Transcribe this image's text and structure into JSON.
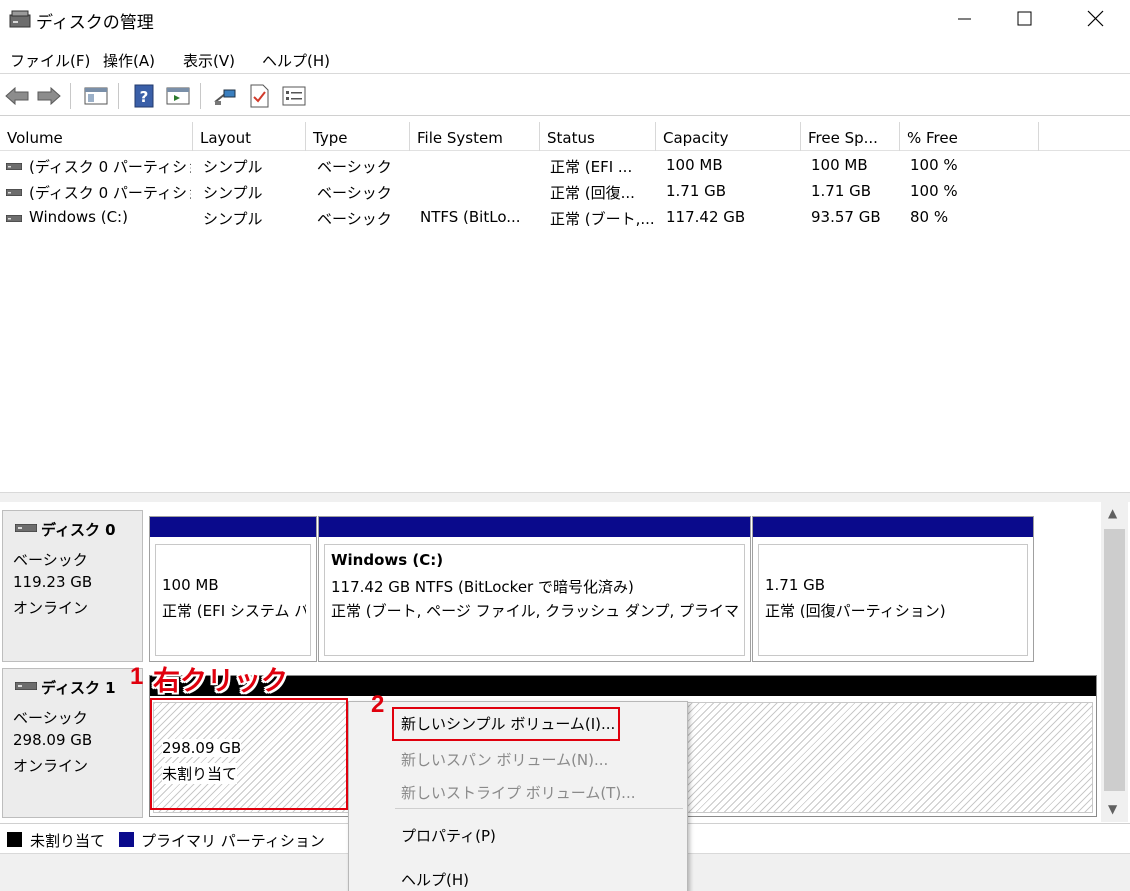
{
  "window": {
    "title": "ディスクの管理"
  },
  "menu": [
    "ファイル(F)",
    "操作(A)",
    "表示(V)",
    "ヘルプ(H)"
  ],
  "columns": [
    "Volume",
    "Layout",
    "Type",
    "File System",
    "Status",
    "Capacity",
    "Free Sp...",
    "% Free"
  ],
  "volumes": [
    {
      "volume": "(ディスク 0 パーティショ...",
      "layout": "シンプル",
      "type": "ベーシック",
      "fs": "",
      "status": "正常 (EFI ...",
      "capacity": "100 MB",
      "free": "100 MB",
      "pct": "100 %"
    },
    {
      "volume": "(ディスク 0 パーティショ...",
      "layout": "シンプル",
      "type": "ベーシック",
      "fs": "",
      "status": "正常 (回復...",
      "capacity": "1.71 GB",
      "free": "1.71 GB",
      "pct": "100 %"
    },
    {
      "volume": "Windows (C:)",
      "layout": "シンプル",
      "type": "ベーシック",
      "fs": "NTFS (BitLo...",
      "status": "正常 (ブート,...",
      "capacity": "117.42 GB",
      "free": "93.57 GB",
      "pct": "80 %"
    }
  ],
  "disk0": {
    "name": "ディスク 0",
    "type": "ベーシック",
    "size": "119.23 GB",
    "state": "オンライン",
    "partitions": [
      {
        "title": "",
        "line1": "100 MB",
        "line2": "正常 (EFI システム パ"
      },
      {
        "title": "Windows  (C:)",
        "line1": "117.42 GB NTFS (BitLocker で暗号化済み)",
        "line2": "正常 (ブート, ページ ファイル, クラッシュ ダンプ, プライマリ パーテ"
      },
      {
        "title": "",
        "line1": "1.71 GB",
        "line2": "正常 (回復パーティション)"
      }
    ]
  },
  "disk1": {
    "name": "ディスク 1",
    "type": "ベーシック",
    "size": "298.09 GB",
    "state": "オンライン",
    "unallocated": {
      "line1": "298.09 GB",
      "line2": "未割り当て"
    }
  },
  "legend": {
    "unallocated": "未割り当て",
    "primary": "プライマリ パーティション"
  },
  "context_menu": {
    "new_simple": "新しいシンプル ボリューム(I)...",
    "new_spanned": "新しいスパン ボリューム(N)...",
    "new_striped": "新しいストライプ ボリューム(T)...",
    "properties": "プロパティ(P)",
    "help": "ヘルプ(H)"
  },
  "annotations": {
    "step1_num": "1",
    "step1_label": "右クリック",
    "step2_num": "2"
  },
  "colors": {
    "primary_partition": "#0a0a8c",
    "unallocated": "#000000",
    "annotation": "#e0000d"
  }
}
